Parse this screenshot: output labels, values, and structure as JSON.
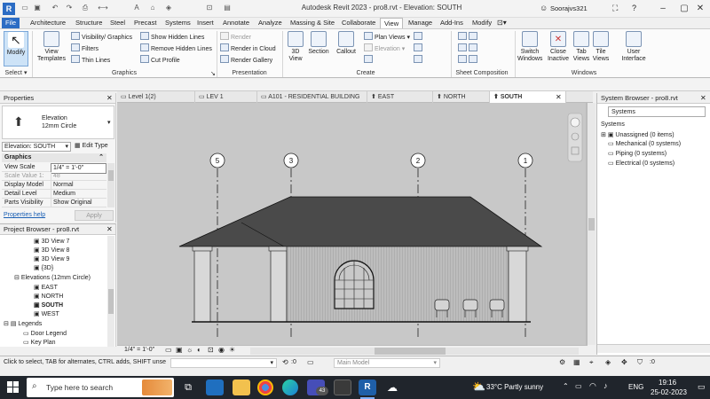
{
  "window": {
    "title": "Autodesk Revit 2023 - pro8.rvt - Elevation: SOUTH",
    "user": "Soorajvs321"
  },
  "ribbon_tabs": [
    "File",
    "Architecture",
    "Structure",
    "Steel",
    "Precast",
    "Systems",
    "Insert",
    "Annotate",
    "Analyze",
    "Massing & Site",
    "Collaborate",
    "View",
    "Manage",
    "Add-Ins",
    "Modify"
  ],
  "ribbon": {
    "select": {
      "modify": "Modify",
      "group": "Select"
    },
    "graphics": {
      "view_templates": "View Templates",
      "visibility": "Visibility/ Graphics",
      "filters": "Filters",
      "thin_lines": "Thin Lines",
      "show_hidden": "Show Hidden Lines",
      "remove_hidden": "Remove Hidden Lines",
      "cut_profile": "Cut Profile",
      "group": "Graphics"
    },
    "presentation": {
      "render": "Render",
      "render_cloud": "Render in Cloud",
      "render_gallery": "Render Gallery",
      "group": "Presentation"
    },
    "create": {
      "view3d": "3D View",
      "section": "Section",
      "callout": "Callout",
      "plan_views": "Plan Views",
      "elevation": "Elevation",
      "group": "Create"
    },
    "sheet": {
      "group": "Sheet Composition"
    },
    "windows": {
      "switch": "Switch Windows",
      "close_inactive": "Close Inactive",
      "tab_views": "Tab Views",
      "tile_views": "Tile Views",
      "user_interface": "User Interface",
      "group": "Windows"
    }
  },
  "properties": {
    "header": "Properties",
    "type_name": "Elevation",
    "type_sub": "12mm Circle",
    "selector": "Elevation: SOUTH",
    "edit_type": "Edit Type",
    "section": "Graphics",
    "rows": [
      {
        "k": "View Scale",
        "v": "1/4\" = 1'-0\""
      },
      {
        "k": "Scale Value    1:",
        "v": "48"
      },
      {
        "k": "Display Model",
        "v": "Normal"
      },
      {
        "k": "Detail Level",
        "v": "Medium"
      },
      {
        "k": "Parts Visibility",
        "v": "Show Original"
      }
    ],
    "help": "Properties help",
    "apply": "Apply"
  },
  "project_browser": {
    "header": "Project Browser - pro8.rvt",
    "items": [
      "3D View 7",
      "3D View 8",
      "3D View 9",
      "{3D}",
      "Elevations (12mm Circle)",
      "EAST",
      "NORTH",
      "SOUTH",
      "WEST",
      "Legends",
      "Door Legend",
      "Key Plan"
    ]
  },
  "view_tabs": [
    "Level 1(2)",
    "LEV 1",
    "A101 - RESIDENTIAL BUILDING",
    "EAST",
    "NORTH",
    "SOUTH"
  ],
  "grid_labels": [
    "5",
    "3",
    "2",
    "1"
  ],
  "view_bar": {
    "scale": "1/4\" = 1'-0\""
  },
  "system_browser": {
    "header": "System Browser - pro8.rvt",
    "dropdown": "Systems",
    "column": "Systems",
    "items": [
      "Unassigned (0 items)",
      "Mechanical (0 systems)",
      "Piping (0 systems)",
      "Electrical (0 systems)"
    ]
  },
  "status": {
    "hint": "Click to select, TAB for alternates, CTRL adds, SHIFT unse",
    "count": ":0",
    "model": "Main Model"
  },
  "taskbar": {
    "search": "Type here to search",
    "weather": "33°C  Partly sunny",
    "lang": "ENG",
    "time": "19:16",
    "date": "25-02-2023",
    "badge": "43"
  },
  "colors": {
    "accent": "#2b6cc4",
    "taskbar": "#20252c",
    "canvas": "#c8c8c8"
  }
}
